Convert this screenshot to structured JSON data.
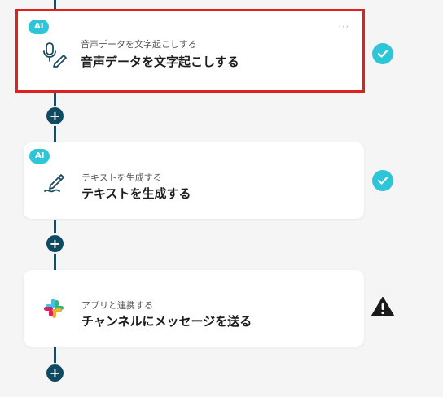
{
  "steps": [
    {
      "badge": "AI",
      "subtitle": "音声データを文字起こしする",
      "title": "音声データを文字起こしする",
      "icon": "microphone-pen-icon",
      "status": "success",
      "more_menu": "⋯"
    },
    {
      "badge": "AI",
      "subtitle": "テキストを生成する",
      "title": "テキストを生成する",
      "icon": "pen-icon",
      "status": "success"
    },
    {
      "subtitle": "アプリと連携する",
      "title": "チャンネルにメッセージを送る",
      "icon": "slack-icon",
      "status": "warning"
    }
  ],
  "add_step_label": "+",
  "colors": {
    "accent": "#2cc6d8",
    "connector": "#0f4a63",
    "selected_outline": "#e0201e",
    "warning": "#1a1a1a"
  }
}
